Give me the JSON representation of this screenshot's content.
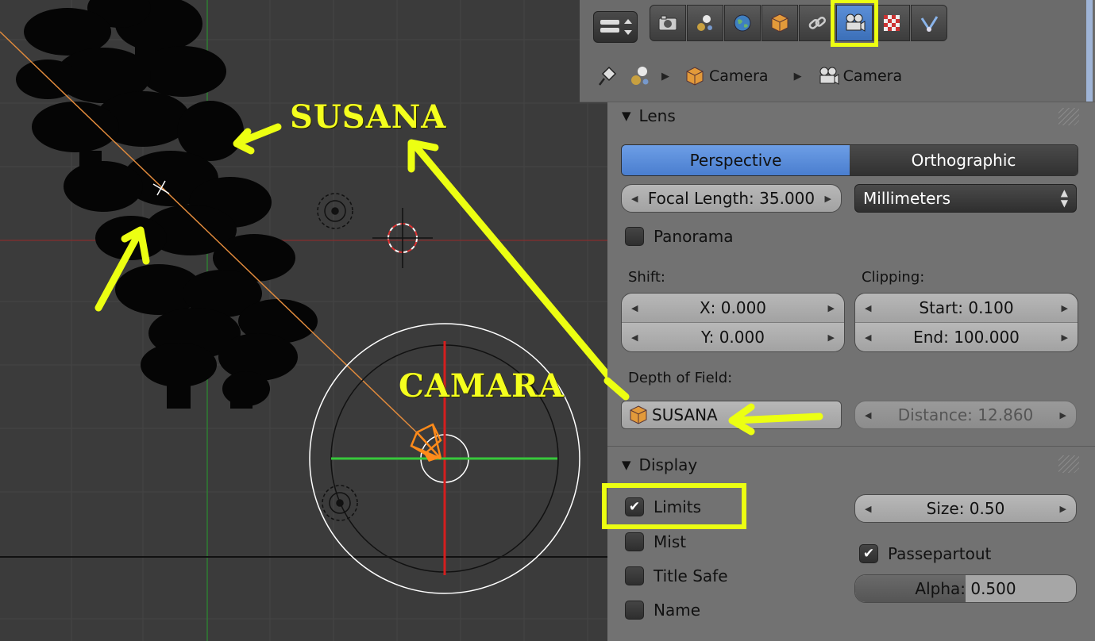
{
  "annotations": {
    "susana": "SUSANA",
    "camara": "CAMARA"
  },
  "colors": {
    "annotation": "#ecff12",
    "active_tab": "#5c8fd8",
    "x_axis": "#b83232",
    "y_axis": "#37c83b",
    "camera": "#ff8a1a"
  },
  "header": {
    "tabs": [
      "render-icon",
      "scene-icon",
      "world-icon",
      "object-icon",
      "constraints-icon",
      "camera-data-icon",
      "texture-icon",
      "physics-icon"
    ],
    "active_tab": "camera-data-icon",
    "breadcrumb": [
      "Camera",
      "Camera"
    ]
  },
  "lens": {
    "title": "Lens",
    "mode_perspective": "Perspective",
    "mode_orthographic": "Orthographic",
    "focal_length": "Focal Length: 35.000",
    "units": "Millimeters",
    "panorama": "Panorama",
    "shift_label": "Shift:",
    "shift_x": "X: 0.000",
    "shift_y": "Y: 0.000",
    "clipping_label": "Clipping:",
    "clip_start": "Start: 0.100",
    "clip_end": "End: 100.000",
    "dof_label": "Depth of Field:",
    "dof_object": "SUSANA",
    "dof_distance": "Distance: 12.860"
  },
  "display": {
    "title": "Display",
    "limits": "Limits",
    "limits_checked": true,
    "mist": "Mist",
    "title_safe": "Title Safe",
    "name": "Name",
    "size": "Size: 0.50",
    "passepartout": "Passepartout",
    "passepartout_checked": true,
    "alpha": "Alpha: 0.500",
    "alpha_value": 0.5
  }
}
